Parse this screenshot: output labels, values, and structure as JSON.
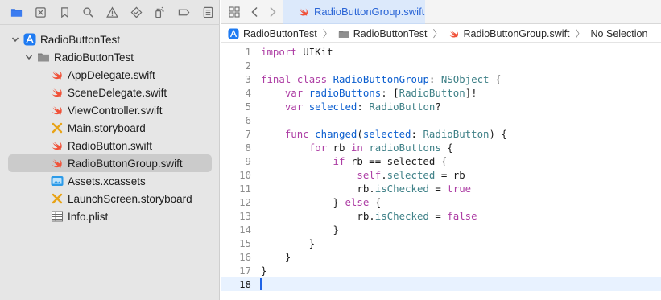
{
  "navigator": {
    "toolbar": [
      {
        "name": "project-navigator-folder-icon",
        "color": "#2f6fe4"
      },
      {
        "name": "source-control-icon"
      },
      {
        "name": "bookmark-icon"
      },
      {
        "name": "find-icon"
      },
      {
        "name": "issue-warning-icon"
      },
      {
        "name": "test-diamond-icon"
      },
      {
        "name": "debug-spray-icon"
      },
      {
        "name": "breakpoint-icon"
      },
      {
        "name": "report-icon"
      }
    ],
    "tree": [
      {
        "label": "RadioButtonTest",
        "icon": "app-project-icon",
        "indent": 0,
        "disclosure": "open"
      },
      {
        "label": "RadioButtonTest",
        "icon": "folder-icon",
        "indent": 1,
        "disclosure": "open"
      },
      {
        "label": "AppDelegate.swift",
        "icon": "swift-file-icon",
        "indent": 2
      },
      {
        "label": "SceneDelegate.swift",
        "icon": "swift-file-icon",
        "indent": 2
      },
      {
        "label": "ViewController.swift",
        "icon": "swift-file-icon",
        "indent": 2
      },
      {
        "label": "Main.storyboard",
        "icon": "storyboard-icon",
        "indent": 2
      },
      {
        "label": "RadioButton.swift",
        "icon": "swift-file-icon",
        "indent": 2
      },
      {
        "label": "RadioButtonGroup.swift",
        "icon": "swift-file-icon",
        "indent": 2,
        "selected": true
      },
      {
        "label": "Assets.xcassets",
        "icon": "asset-catalog-icon",
        "indent": 2
      },
      {
        "label": "LaunchScreen.storyboard",
        "icon": "storyboard-icon",
        "indent": 2
      },
      {
        "label": "Info.plist",
        "icon": "plist-table-icon",
        "indent": 2
      }
    ]
  },
  "editor": {
    "tab": {
      "label": "RadioButtonGroup.swift"
    },
    "jumpbar": [
      "RadioButtonTest",
      "RadioButtonTest",
      "RadioButtonGroup.swift",
      "No Selection"
    ],
    "current_line": 18,
    "lines": [
      [
        [
          "kw",
          "import"
        ],
        [
          "plain",
          " UIKit"
        ]
      ],
      [],
      [
        [
          "kw",
          "final"
        ],
        [
          "plain",
          " "
        ],
        [
          "kw",
          "class"
        ],
        [
          "plain",
          " "
        ],
        [
          "decl",
          "RadioButtonGroup"
        ],
        [
          "plain",
          ": "
        ],
        [
          "type",
          "NSObject"
        ],
        [
          "plain",
          " {"
        ]
      ],
      [
        [
          "plain",
          "    "
        ],
        [
          "kw",
          "var"
        ],
        [
          "plain",
          " "
        ],
        [
          "decl",
          "radioButtons"
        ],
        [
          "plain",
          ": ["
        ],
        [
          "type",
          "RadioButton"
        ],
        [
          "plain",
          "]!"
        ]
      ],
      [
        [
          "plain",
          "    "
        ],
        [
          "kw",
          "var"
        ],
        [
          "plain",
          " "
        ],
        [
          "decl",
          "selected"
        ],
        [
          "plain",
          ": "
        ],
        [
          "type",
          "RadioButton"
        ],
        [
          "plain",
          "?"
        ]
      ],
      [],
      [
        [
          "plain",
          "    "
        ],
        [
          "kw",
          "func"
        ],
        [
          "plain",
          " "
        ],
        [
          "decl",
          "changed"
        ],
        [
          "plain",
          "("
        ],
        [
          "decl",
          "selected"
        ],
        [
          "plain",
          ": "
        ],
        [
          "type",
          "RadioButton"
        ],
        [
          "plain",
          ") {"
        ]
      ],
      [
        [
          "plain",
          "        "
        ],
        [
          "kw",
          "for"
        ],
        [
          "plain",
          " rb "
        ],
        [
          "kw",
          "in"
        ],
        [
          "plain",
          " "
        ],
        [
          "prop",
          "radioButtons"
        ],
        [
          "plain",
          " {"
        ]
      ],
      [
        [
          "plain",
          "            "
        ],
        [
          "kw",
          "if"
        ],
        [
          "plain",
          " rb == selected {"
        ]
      ],
      [
        [
          "plain",
          "                "
        ],
        [
          "kw",
          "self"
        ],
        [
          "plain",
          "."
        ],
        [
          "prop",
          "selected"
        ],
        [
          "plain",
          " = rb"
        ]
      ],
      [
        [
          "plain",
          "                rb."
        ],
        [
          "prop",
          "isChecked"
        ],
        [
          "plain",
          " = "
        ],
        [
          "kw",
          "true"
        ]
      ],
      [
        [
          "plain",
          "            } "
        ],
        [
          "kw",
          "else"
        ],
        [
          "plain",
          " {"
        ]
      ],
      [
        [
          "plain",
          "                rb."
        ],
        [
          "prop",
          "isChecked"
        ],
        [
          "plain",
          " = "
        ],
        [
          "kw",
          "false"
        ]
      ],
      [
        [
          "plain",
          "            }"
        ]
      ],
      [
        [
          "plain",
          "        }"
        ]
      ],
      [
        [
          "plain",
          "    }"
        ]
      ],
      [
        [
          "plain",
          "}"
        ]
      ],
      []
    ]
  },
  "colors": {
    "keyword": "#ad3da4",
    "type": "#3e8087",
    "declaration": "#0b5ecf",
    "tab_text": "#2a65d6",
    "swift_orange": "#f05138",
    "storyboard_yellow": "#e8a317"
  }
}
